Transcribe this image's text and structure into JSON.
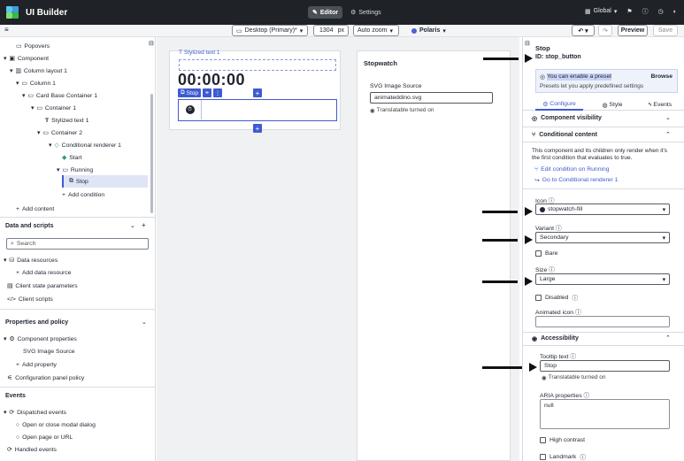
{
  "topbar": {
    "app_title": "UI Builder",
    "tab_editor": "Editor",
    "tab_settings": "Settings",
    "global": "Global"
  },
  "toolbar": {
    "device": "Desktop (Primary)*",
    "width_value": "1304",
    "width_unit": "px",
    "zoom": "Auto zoom",
    "theme": "Polaris",
    "preview": "Preview",
    "save": "Save"
  },
  "tree": {
    "popovers": "Popovers",
    "component": "Component",
    "column_layout": "Column layout 1",
    "column": "Column 1",
    "card_base": "Card Base Container 1",
    "container1": "Container 1",
    "stylized_text": "Stylized text 1",
    "container2": "Container 2",
    "cond_renderer": "Conditional renderer 1",
    "start": "Start",
    "running": "Running",
    "stop": "Stop",
    "add_condition": "Add condition",
    "add_content": "Add content"
  },
  "data_scripts": {
    "title": "Data and scripts",
    "search_placeholder": "Search",
    "data_resources": "Data resources",
    "add_data_resource": "Add data resource",
    "client_state": "Client state parameters",
    "client_scripts": "Client scripts"
  },
  "properties_policy": {
    "title": "Properties and policy",
    "component_properties": "Component properties",
    "svg_image_source": "SVG Image Source",
    "add_property": "Add property",
    "config_policy": "Configuration panel policy"
  },
  "events": {
    "title": "Events",
    "dispatched": "Dispatched events",
    "open_close_modal": "Open or close modal dialog",
    "open_page": "Open page or URL",
    "handled": "Handled events"
  },
  "canvas": {
    "stylized_tag": "Stylized text 1",
    "timer": "00:00:00",
    "stop_tag": "Stop",
    "stopwatch_title": "Stopwatch",
    "svg_label": "SVG Image Source",
    "svg_value": "animateddino.svg",
    "translatable": "Translatable turned on"
  },
  "panel": {
    "component_name": "Stop",
    "component_id": "ID: stop_button",
    "preset_title": "You can enable a preset",
    "preset_browse": "Browse",
    "preset_desc": "Presets let you apply predefined settings",
    "tab_configure": "Configure",
    "tab_style": "Style",
    "tab_events": "Events",
    "visibility": "Component visibility",
    "conditional_content": "Conditional content",
    "cond_desc": "This component and its children only render when it's the first condition that evaluates to true.",
    "edit_condition": "Edit condition on Running",
    "goto_renderer": "Go to Conditional renderer 1",
    "icon_label": "Icon",
    "icon_value": "stopwatch-fill",
    "variant_label": "Variant",
    "variant_value": "Secondary",
    "bare_label": "Bare",
    "size_label": "Size",
    "size_value": "Large",
    "disabled_label": "Disabled",
    "animated_icon_label": "Animated icon",
    "accessibility": "Accessibility",
    "tooltip_label": "Tooltip text",
    "tooltip_value": "Stop",
    "tooltip_translatable": "Translatable turned on",
    "aria_label": "ARIA properties",
    "aria_value": "null",
    "high_contrast": "High contrast",
    "landmark": "Landmark"
  },
  "colors": {
    "topbar": "#1f2226",
    "accent": "#3f5bd1",
    "preset_bg": "#eef2fb"
  }
}
